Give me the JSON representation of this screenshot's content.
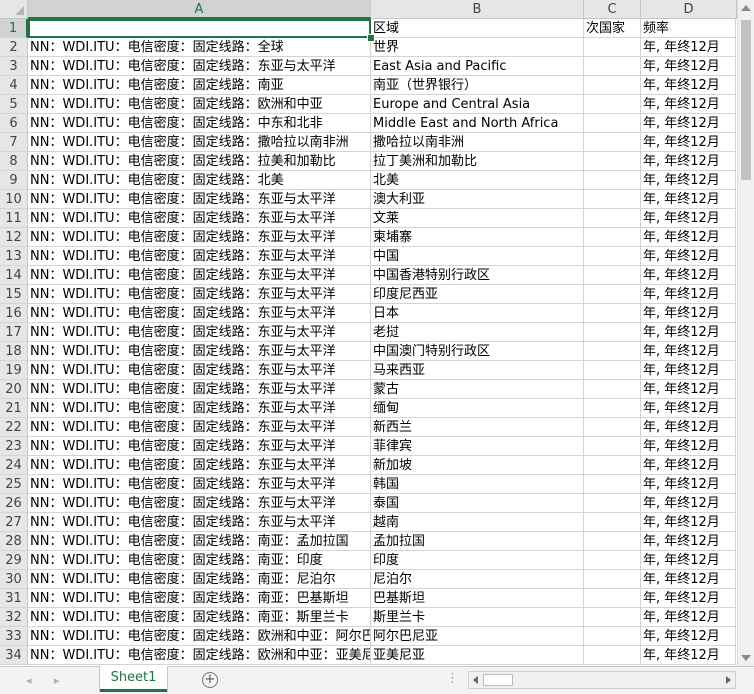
{
  "sheet": {
    "columns": [
      "A",
      "B",
      "C",
      "D"
    ],
    "selected_column": "A",
    "selected_row": 1,
    "rows": [
      {
        "num": "1",
        "a": "",
        "b": "区域",
        "c": "次国家",
        "d": "频率"
      },
      {
        "num": "2",
        "a": "NN：WDI.ITU：电信密度：固定线路：全球",
        "b": "世界",
        "c": "",
        "d": "年, 年终12月"
      },
      {
        "num": "3",
        "a": "NN：WDI.ITU：电信密度：固定线路：东亚与太平洋",
        "b": "East Asia and Pacific",
        "c": "",
        "d": "年, 年终12月"
      },
      {
        "num": "4",
        "a": "NN：WDI.ITU：电信密度：固定线路：南亚",
        "b": "南亚（世界银行）",
        "c": "",
        "d": "年, 年终12月"
      },
      {
        "num": "5",
        "a": "NN：WDI.ITU：电信密度：固定线路：欧洲和中亚",
        "b": "Europe and Central Asia",
        "c": "",
        "d": "年, 年终12月"
      },
      {
        "num": "6",
        "a": "NN：WDI.ITU：电信密度：固定线路：中东和北非",
        "b": "Middle East and North Africa",
        "c": "",
        "d": "年, 年终12月"
      },
      {
        "num": "7",
        "a": "NN：WDI.ITU：电信密度：固定线路：撒哈拉以南非洲",
        "b": "撒哈拉以南非洲",
        "c": "",
        "d": "年, 年终12月"
      },
      {
        "num": "8",
        "a": "NN：WDI.ITU：电信密度：固定线路：拉美和加勒比",
        "b": "拉丁美洲和加勒比",
        "c": "",
        "d": "年, 年终12月"
      },
      {
        "num": "9",
        "a": "NN：WDI.ITU：电信密度：固定线路：北美",
        "b": "北美",
        "c": "",
        "d": "年, 年终12月"
      },
      {
        "num": "10",
        "a": "NN：WDI.ITU：电信密度：固定线路：东亚与太平洋",
        "b": "澳大利亚",
        "c": "",
        "d": "年, 年终12月"
      },
      {
        "num": "11",
        "a": "NN：WDI.ITU：电信密度：固定线路：东亚与太平洋",
        "b": "文莱",
        "c": "",
        "d": "年, 年终12月"
      },
      {
        "num": "12",
        "a": "NN：WDI.ITU：电信密度：固定线路：东亚与太平洋",
        "b": "柬埔寨",
        "c": "",
        "d": "年, 年终12月"
      },
      {
        "num": "13",
        "a": "NN：WDI.ITU：电信密度：固定线路：东亚与太平洋",
        "b": "中国",
        "c": "",
        "d": "年, 年终12月"
      },
      {
        "num": "14",
        "a": "NN：WDI.ITU：电信密度：固定线路：东亚与太平洋",
        "b": "中国香港特别行政区",
        "c": "",
        "d": "年, 年终12月"
      },
      {
        "num": "15",
        "a": "NN：WDI.ITU：电信密度：固定线路：东亚与太平洋",
        "b": "印度尼西亚",
        "c": "",
        "d": "年, 年终12月"
      },
      {
        "num": "16",
        "a": "NN：WDI.ITU：电信密度：固定线路：东亚与太平洋",
        "b": "日本",
        "c": "",
        "d": "年, 年终12月"
      },
      {
        "num": "17",
        "a": "NN：WDI.ITU：电信密度：固定线路：东亚与太平洋",
        "b": "老挝",
        "c": "",
        "d": "年, 年终12月"
      },
      {
        "num": "18",
        "a": "NN：WDI.ITU：电信密度：固定线路：东亚与太平洋",
        "b": "中国澳门特别行政区",
        "c": "",
        "d": "年, 年终12月"
      },
      {
        "num": "19",
        "a": "NN：WDI.ITU：电信密度：固定线路：东亚与太平洋",
        "b": "马来西亚",
        "c": "",
        "d": "年, 年终12月"
      },
      {
        "num": "20",
        "a": "NN：WDI.ITU：电信密度：固定线路：东亚与太平洋",
        "b": "蒙古",
        "c": "",
        "d": "年, 年终12月"
      },
      {
        "num": "21",
        "a": "NN：WDI.ITU：电信密度：固定线路：东亚与太平洋",
        "b": "缅甸",
        "c": "",
        "d": "年, 年终12月"
      },
      {
        "num": "22",
        "a": "NN：WDI.ITU：电信密度：固定线路：东亚与太平洋",
        "b": "新西兰",
        "c": "",
        "d": "年, 年终12月"
      },
      {
        "num": "23",
        "a": "NN：WDI.ITU：电信密度：固定线路：东亚与太平洋",
        "b": "菲律宾",
        "c": "",
        "d": "年, 年终12月"
      },
      {
        "num": "24",
        "a": "NN：WDI.ITU：电信密度：固定线路：东亚与太平洋",
        "b": "新加坡",
        "c": "",
        "d": "年, 年终12月"
      },
      {
        "num": "25",
        "a": "NN：WDI.ITU：电信密度：固定线路：东亚与太平洋",
        "b": "韩国",
        "c": "",
        "d": "年, 年终12月"
      },
      {
        "num": "26",
        "a": "NN：WDI.ITU：电信密度：固定线路：东亚与太平洋",
        "b": "泰国",
        "c": "",
        "d": "年, 年终12月"
      },
      {
        "num": "27",
        "a": "NN：WDI.ITU：电信密度：固定线路：东亚与太平洋",
        "b": "越南",
        "c": "",
        "d": "年, 年终12月"
      },
      {
        "num": "28",
        "a": "NN：WDI.ITU：电信密度：固定线路：南亚：孟加拉国",
        "b": "孟加拉国",
        "c": "",
        "d": "年, 年终12月"
      },
      {
        "num": "29",
        "a": "NN：WDI.ITU：电信密度：固定线路：南亚：印度",
        "b": "印度",
        "c": "",
        "d": "年, 年终12月"
      },
      {
        "num": "30",
        "a": "NN：WDI.ITU：电信密度：固定线路：南亚：尼泊尔",
        "b": "尼泊尔",
        "c": "",
        "d": "年, 年终12月"
      },
      {
        "num": "31",
        "a": "NN：WDI.ITU：电信密度：固定线路：南亚：巴基斯坦",
        "b": "巴基斯坦",
        "c": "",
        "d": "年, 年终12月"
      },
      {
        "num": "32",
        "a": "NN：WDI.ITU：电信密度：固定线路：南亚：斯里兰卡",
        "b": "斯里兰卡",
        "c": "",
        "d": "年, 年终12月"
      },
      {
        "num": "33",
        "a": "NN：WDI.ITU：电信密度：固定线路：欧洲和中亚：阿尔巴尼亚",
        "b": "阿尔巴尼亚",
        "c": "",
        "d": "年, 年终12月"
      },
      {
        "num": "34",
        "a": "NN：WDI.ITU：电信密度：固定线路：欧洲和中亚：亚美尼亚",
        "b": "亚美尼亚",
        "c": "",
        "d": "年, 年终12月"
      }
    ]
  },
  "tabs": {
    "active_label": "Sheet1",
    "add_symbol": "+",
    "overflow_dots": "⋮"
  },
  "icons": {
    "scroll_left": "◂",
    "scroll_right": "▸"
  }
}
